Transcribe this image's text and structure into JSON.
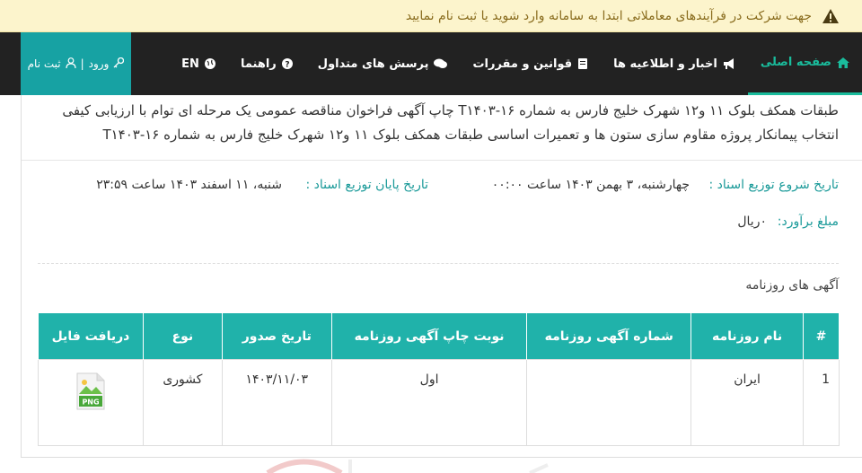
{
  "alert": {
    "text": "جهت شرکت در فرآیندهای معاملاتی ابتدا به سامانه وارد شوید یا ثبت نام نمایید",
    "icon": "warning-icon"
  },
  "nav": {
    "items": [
      {
        "label": "صفحه اصلی",
        "icon": "home-icon"
      },
      {
        "label": "اخبار و اطلاعیه ها",
        "icon": "bullhorn-icon"
      },
      {
        "label": "قوانین و مقررات",
        "icon": "book-icon"
      },
      {
        "label": "پرسش های متداول",
        "icon": "comments-icon"
      },
      {
        "label": "راهنما",
        "icon": "question-circle-icon"
      },
      {
        "label": "EN",
        "icon": "globe-icon"
      }
    ],
    "login": {
      "login_label": "ورود",
      "separator": "|",
      "register_label": "ثبت نام"
    }
  },
  "tender": {
    "title": "طبقات همکف بلوک ۱۱ و۱۲ شهرک خلیج فارس به شماره ۱۶-T۱۴۰۳ چاپ آگهی فراخوان مناقصه عمومی یک مرحله ای توام با ارزیابی کیفی انتخاب پیمانکار پروژه مقاوم سازی ستون ها و تعمیرات اساسی طبقات همکف بلوک ۱۱ و۱۲ شهرک خلیج فارس به شماره ۱۶-T۱۴۰۳",
    "start_label": "تاریخ شروع توزیع اسناد :",
    "start_value": "چهارشنبه، ۳ بهمن ۱۴۰۳ ساعت ۰۰:۰۰",
    "end_label": "تاریخ پایان توزیع اسناد :",
    "end_value": "شنبه، ۱۱ اسفند ۱۴۰۳ ساعت ۲۳:۵۹",
    "price_label": "مبلغ برآورد:",
    "price_value": "۰ریال"
  },
  "ads": {
    "section_title": "آگهی های روزنامه",
    "columns": [
      "#",
      "نام روزنامه",
      "شماره آگهی روزنامه",
      "نوبت چاپ آگهی روزنامه",
      "تاریخ صدور",
      "نوع",
      "دریافت فایل"
    ],
    "rows": [
      {
        "index": "1",
        "newspaper": "ایران",
        "ad_number": "",
        "print_turn": "اول",
        "issue_date": "۱۴۰۳/۱۱/۰۳",
        "type": "کشوری",
        "file_label": "PNG",
        "file_icon": "png-file-icon"
      }
    ]
  },
  "colors": {
    "accent": "#1abc9c",
    "teal": "#20b2aa",
    "navbar": "#222222",
    "alert_bg": "#fcf4cc"
  }
}
